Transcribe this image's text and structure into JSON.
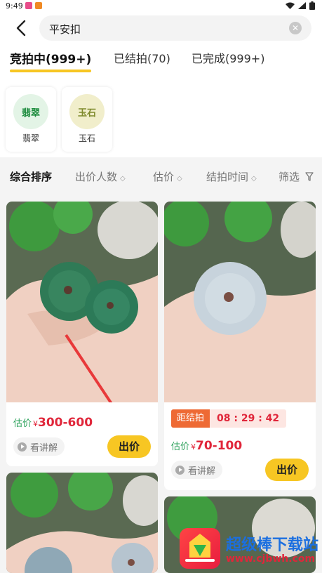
{
  "status": {
    "time": "9:49"
  },
  "search": {
    "query": "平安扣"
  },
  "tabs": [
    {
      "label": "竞拍中(999+)",
      "active": true
    },
    {
      "label": "已结拍(70)",
      "active": false
    },
    {
      "label": "已完成(999+)",
      "active": false
    }
  ],
  "categories": [
    {
      "label": "翡翠",
      "pic_text": "翡翠"
    },
    {
      "label": "玉石",
      "pic_text": "玉石"
    }
  ],
  "filters": {
    "sort": "综合排序",
    "bidders": "出价人数",
    "estimate": "估价",
    "end_time": "结拍时间",
    "filter": "筛选"
  },
  "products": [
    {
      "estimate_label": "估价",
      "currency": "¥",
      "price": "300-600",
      "lecture": "看讲解",
      "bid": "出价"
    },
    {
      "countdown_tag": "距结拍",
      "countdown": "08 : 29 : 42",
      "estimate_label": "估价",
      "currency": "¥",
      "price": "70-100",
      "lecture": "看讲解",
      "bid": "出价"
    }
  ],
  "watermark": {
    "name": "超级棒下载站",
    "url": "www.cjbwh.com"
  },
  "colors": {
    "accent": "#f7c623",
    "price": "#e0263a",
    "estimate": "#2aa05a",
    "countdown": "#ee6a34"
  }
}
